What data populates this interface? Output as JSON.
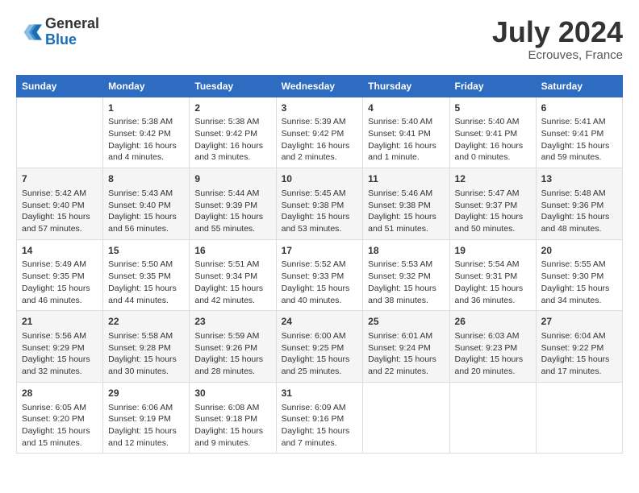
{
  "header": {
    "logo_general": "General",
    "logo_blue": "Blue",
    "month_title": "July 2024",
    "location": "Ecrouves, France"
  },
  "days_of_week": [
    "Sunday",
    "Monday",
    "Tuesday",
    "Wednesday",
    "Thursday",
    "Friday",
    "Saturday"
  ],
  "weeks": [
    [
      {
        "day": "",
        "info": ""
      },
      {
        "day": "1",
        "info": "Sunrise: 5:38 AM\nSunset: 9:42 PM\nDaylight: 16 hours\nand 4 minutes."
      },
      {
        "day": "2",
        "info": "Sunrise: 5:38 AM\nSunset: 9:42 PM\nDaylight: 16 hours\nand 3 minutes."
      },
      {
        "day": "3",
        "info": "Sunrise: 5:39 AM\nSunset: 9:42 PM\nDaylight: 16 hours\nand 2 minutes."
      },
      {
        "day": "4",
        "info": "Sunrise: 5:40 AM\nSunset: 9:41 PM\nDaylight: 16 hours\nand 1 minute."
      },
      {
        "day": "5",
        "info": "Sunrise: 5:40 AM\nSunset: 9:41 PM\nDaylight: 16 hours\nand 0 minutes."
      },
      {
        "day": "6",
        "info": "Sunrise: 5:41 AM\nSunset: 9:41 PM\nDaylight: 15 hours\nand 59 minutes."
      }
    ],
    [
      {
        "day": "7",
        "info": "Sunrise: 5:42 AM\nSunset: 9:40 PM\nDaylight: 15 hours\nand 57 minutes."
      },
      {
        "day": "8",
        "info": "Sunrise: 5:43 AM\nSunset: 9:40 PM\nDaylight: 15 hours\nand 56 minutes."
      },
      {
        "day": "9",
        "info": "Sunrise: 5:44 AM\nSunset: 9:39 PM\nDaylight: 15 hours\nand 55 minutes."
      },
      {
        "day": "10",
        "info": "Sunrise: 5:45 AM\nSunset: 9:38 PM\nDaylight: 15 hours\nand 53 minutes."
      },
      {
        "day": "11",
        "info": "Sunrise: 5:46 AM\nSunset: 9:38 PM\nDaylight: 15 hours\nand 51 minutes."
      },
      {
        "day": "12",
        "info": "Sunrise: 5:47 AM\nSunset: 9:37 PM\nDaylight: 15 hours\nand 50 minutes."
      },
      {
        "day": "13",
        "info": "Sunrise: 5:48 AM\nSunset: 9:36 PM\nDaylight: 15 hours\nand 48 minutes."
      }
    ],
    [
      {
        "day": "14",
        "info": "Sunrise: 5:49 AM\nSunset: 9:35 PM\nDaylight: 15 hours\nand 46 minutes."
      },
      {
        "day": "15",
        "info": "Sunrise: 5:50 AM\nSunset: 9:35 PM\nDaylight: 15 hours\nand 44 minutes."
      },
      {
        "day": "16",
        "info": "Sunrise: 5:51 AM\nSunset: 9:34 PM\nDaylight: 15 hours\nand 42 minutes."
      },
      {
        "day": "17",
        "info": "Sunrise: 5:52 AM\nSunset: 9:33 PM\nDaylight: 15 hours\nand 40 minutes."
      },
      {
        "day": "18",
        "info": "Sunrise: 5:53 AM\nSunset: 9:32 PM\nDaylight: 15 hours\nand 38 minutes."
      },
      {
        "day": "19",
        "info": "Sunrise: 5:54 AM\nSunset: 9:31 PM\nDaylight: 15 hours\nand 36 minutes."
      },
      {
        "day": "20",
        "info": "Sunrise: 5:55 AM\nSunset: 9:30 PM\nDaylight: 15 hours\nand 34 minutes."
      }
    ],
    [
      {
        "day": "21",
        "info": "Sunrise: 5:56 AM\nSunset: 9:29 PM\nDaylight: 15 hours\nand 32 minutes."
      },
      {
        "day": "22",
        "info": "Sunrise: 5:58 AM\nSunset: 9:28 PM\nDaylight: 15 hours\nand 30 minutes."
      },
      {
        "day": "23",
        "info": "Sunrise: 5:59 AM\nSunset: 9:26 PM\nDaylight: 15 hours\nand 28 minutes."
      },
      {
        "day": "24",
        "info": "Sunrise: 6:00 AM\nSunset: 9:25 PM\nDaylight: 15 hours\nand 25 minutes."
      },
      {
        "day": "25",
        "info": "Sunrise: 6:01 AM\nSunset: 9:24 PM\nDaylight: 15 hours\nand 22 minutes."
      },
      {
        "day": "26",
        "info": "Sunrise: 6:03 AM\nSunset: 9:23 PM\nDaylight: 15 hours\nand 20 minutes."
      },
      {
        "day": "27",
        "info": "Sunrise: 6:04 AM\nSunset: 9:22 PM\nDaylight: 15 hours\nand 17 minutes."
      }
    ],
    [
      {
        "day": "28",
        "info": "Sunrise: 6:05 AM\nSunset: 9:20 PM\nDaylight: 15 hours\nand 15 minutes."
      },
      {
        "day": "29",
        "info": "Sunrise: 6:06 AM\nSunset: 9:19 PM\nDaylight: 15 hours\nand 12 minutes."
      },
      {
        "day": "30",
        "info": "Sunrise: 6:08 AM\nSunset: 9:18 PM\nDaylight: 15 hours\nand 9 minutes."
      },
      {
        "day": "31",
        "info": "Sunrise: 6:09 AM\nSunset: 9:16 PM\nDaylight: 15 hours\nand 7 minutes."
      },
      {
        "day": "",
        "info": ""
      },
      {
        "day": "",
        "info": ""
      },
      {
        "day": "",
        "info": ""
      }
    ]
  ]
}
